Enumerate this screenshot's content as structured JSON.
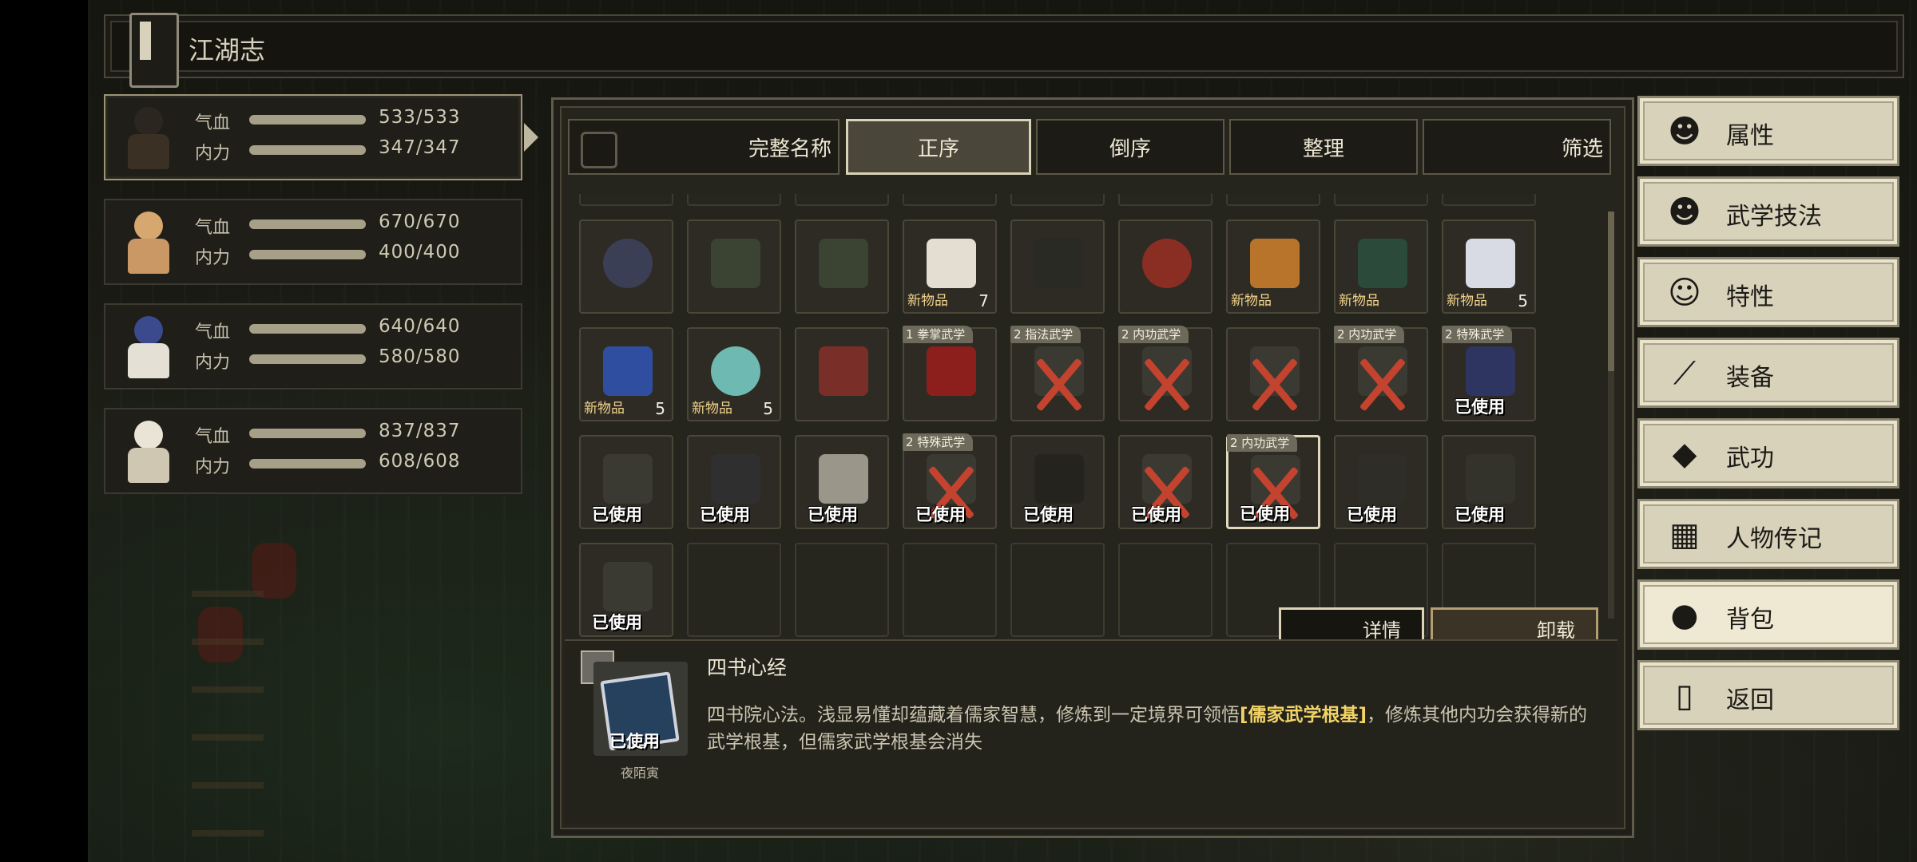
{
  "title": "江湖志",
  "party": [
    {
      "hp_label": "气血",
      "hp": "533/533",
      "mp_label": "内力",
      "mp": "347/347",
      "active": true
    },
    {
      "hp_label": "气血",
      "hp": "670/670",
      "mp_label": "内力",
      "mp": "400/400",
      "active": false
    },
    {
      "hp_label": "气血",
      "hp": "640/640",
      "mp_label": "内力",
      "mp": "580/580",
      "active": false
    },
    {
      "hp_label": "气血",
      "hp": "837/837",
      "mp_label": "内力",
      "mp": "608/608",
      "active": false
    }
  ],
  "tabs": {
    "full_name": "完整名称",
    "ascending": "正序",
    "descending": "倒序",
    "organize": "整理",
    "filter": "筛选"
  },
  "items": [
    {
      "tag": "",
      "label": "",
      "count": "",
      "art": "bomb"
    },
    {
      "tag": "",
      "label": "",
      "count": "",
      "art": "jar"
    },
    {
      "tag": "",
      "label": "",
      "count": "",
      "art": "jar"
    },
    {
      "tag": "",
      "label": "新物品",
      "count": "7",
      "art": "potion"
    },
    {
      "tag": "",
      "label": "",
      "count": "",
      "art": "ring"
    },
    {
      "tag": "",
      "label": "",
      "count": "",
      "art": "pouch"
    },
    {
      "tag": "",
      "label": "新物品",
      "count": "",
      "art": "meat"
    },
    {
      "tag": "",
      "label": "新物品",
      "count": "",
      "art": "knife"
    },
    {
      "tag": "",
      "label": "新物品",
      "count": "5",
      "art": "potion-blue"
    },
    {
      "tag": "",
      "label": "新物品",
      "count": "5",
      "art": "herb"
    },
    {
      "tag": "",
      "label": "新物品",
      "count": "5",
      "art": "gems"
    },
    {
      "tag": "",
      "label": "",
      "count": "",
      "art": "scroll"
    },
    {
      "tag": "1 拳掌武学",
      "label": "",
      "count": "",
      "art": "book"
    },
    {
      "tag": "2 指法武学",
      "label": "",
      "count": "",
      "art": "cross"
    },
    {
      "tag": "2 内功武学",
      "label": "",
      "count": "",
      "art": "cross"
    },
    {
      "tag": "",
      "label": "",
      "count": "",
      "art": "cross"
    },
    {
      "tag": "2 内功武学",
      "label": "",
      "count": "",
      "art": "cross"
    },
    {
      "tag": "2 特殊武学",
      "label": "已使用",
      "count": "",
      "art": "cloth"
    },
    {
      "tag": "",
      "label": "已使用",
      "count": "",
      "art": "fork"
    },
    {
      "tag": "",
      "label": "已使用",
      "count": "",
      "art": "armor"
    },
    {
      "tag": "",
      "label": "已使用",
      "count": "",
      "art": "horse"
    },
    {
      "tag": "2 特殊武学",
      "label": "已使用",
      "count": "",
      "art": "cross"
    },
    {
      "tag": "",
      "label": "已使用",
      "count": "",
      "art": "boots"
    },
    {
      "tag": "",
      "label": "已使用",
      "count": "",
      "art": "cross"
    },
    {
      "tag": "2 内功武学",
      "label": "已使用",
      "count": "",
      "art": "cross",
      "selected": true
    },
    {
      "tag": "",
      "label": "已使用",
      "count": "",
      "art": "bow"
    },
    {
      "tag": "",
      "label": "已使用",
      "count": "",
      "art": "robe"
    },
    {
      "tag": "",
      "label": "已使用",
      "count": "",
      "art": "fork"
    }
  ],
  "buttons": {
    "details": "详情",
    "unequip": "卸载"
  },
  "detail": {
    "name": "四书心经",
    "used": "已使用",
    "owner": "夜陌寅",
    "desc_before": "四书院心法。浅显易懂却蕴藏着儒家智慧，修炼到一定境界可领悟",
    "desc_highlight": "[儒家武学根基]",
    "desc_after": "，修炼其他内功会获得新的武学根基，但儒家武学根基会消失"
  },
  "menu": [
    {
      "label": "属性",
      "icon": "person-icon"
    },
    {
      "label": "武学技法",
      "icon": "skill-person-icon"
    },
    {
      "label": "特性",
      "icon": "trait-person-icon"
    },
    {
      "label": "装备",
      "icon": "sword-icon"
    },
    {
      "label": "武功",
      "icon": "book-icon"
    },
    {
      "label": "人物传记",
      "icon": "biography-icon"
    },
    {
      "label": "背包",
      "icon": "bag-icon",
      "selected": true
    },
    {
      "label": "返回",
      "icon": "door-icon"
    }
  ]
}
